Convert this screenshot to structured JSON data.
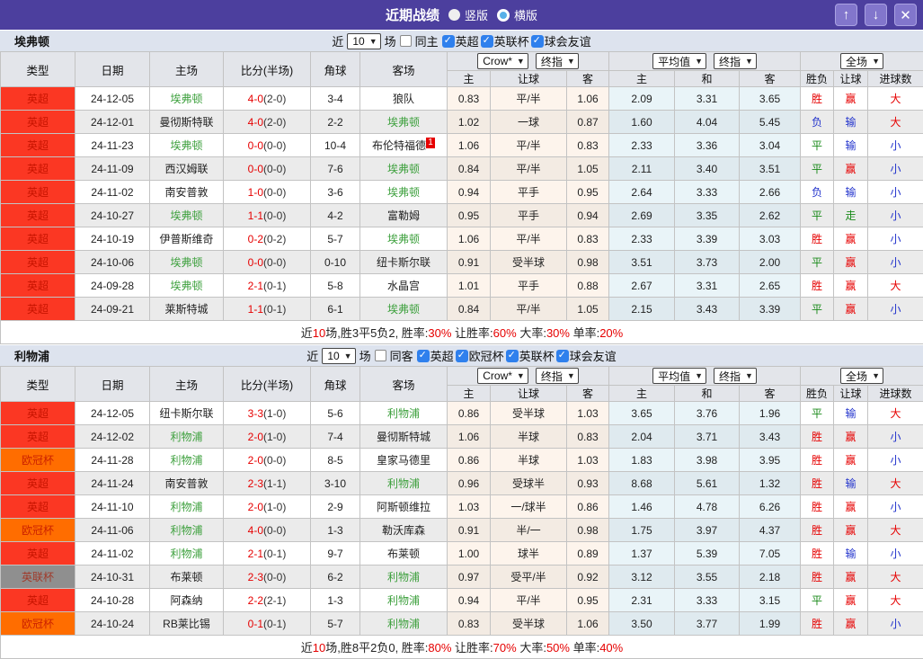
{
  "titlebar": {
    "title": "近期战绩",
    "radio_vertical": "竖版",
    "radio_horizontal": "横版",
    "buttons": {
      "up": "↑",
      "down": "↓",
      "close": "✕"
    }
  },
  "table_header": {
    "cols": [
      "类型",
      "日期",
      "主场",
      "比分(半场)",
      "角球",
      "客场"
    ],
    "sub": [
      "主",
      "让球",
      "客",
      "主",
      "和",
      "客",
      "胜负",
      "让球",
      "进球数"
    ],
    "selects": {
      "bookmaker": "Crow*",
      "asian_time": "终指",
      "euro_source": "平均值",
      "euro_time": "终指",
      "period": "全场"
    }
  },
  "type_colors": {
    "英超": {
      "bg": "#fb3723",
      "fg": "#c81400"
    },
    "欧冠杯": {
      "bg": "#ff6d00",
      "fg": "#cc2200"
    },
    "英联杯": {
      "bg": "#8f8f8f",
      "fg": "#a03a2a"
    }
  },
  "result_colors": {
    "胜": "#e60000",
    "平": "#1a8a1a",
    "负": "#2233cc",
    "赢": "#e60000",
    "走": "#1a8a1a",
    "输": "#2233cc",
    "大": "#e60000",
    "小": "#2233cc"
  },
  "sections": [
    {
      "team": "埃弗顿",
      "filter": {
        "prefix": "近",
        "count": "10",
        "suffix": "场",
        "same": "同主",
        "leagues": [
          "英超",
          "英联杯",
          "球会友谊"
        ]
      },
      "rows": [
        {
          "type": "英超",
          "date": "24-12-05",
          "home": "埃弗顿",
          "homeFocal": true,
          "score": "4-0",
          "half": "(2-0)",
          "corner": "3-4",
          "away": "狼队",
          "awayFocal": false,
          "ah": "0.83",
          "hcap": "平/半",
          "aa": "1.06",
          "eh": "2.09",
          "ed": "3.31",
          "ea": "3.65",
          "wl": "胜",
          "hd": "赢",
          "gl": "大"
        },
        {
          "type": "英超",
          "date": "24-12-01",
          "home": "曼彻斯特联",
          "homeFocal": false,
          "score": "4-0",
          "half": "(2-0)",
          "corner": "2-2",
          "away": "埃弗顿",
          "awayFocal": true,
          "ah": "1.02",
          "hcap": "一球",
          "aa": "0.87",
          "eh": "1.60",
          "ed": "4.04",
          "ea": "5.45",
          "wl": "负",
          "hd": "输",
          "gl": "大"
        },
        {
          "type": "英超",
          "date": "24-11-23",
          "home": "埃弗顿",
          "homeFocal": true,
          "score": "0-0",
          "half": "(0-0)",
          "corner": "10-4",
          "away": "布伦特福德",
          "awayFocal": false,
          "badge": "1",
          "ah": "1.06",
          "hcap": "平/半",
          "aa": "0.83",
          "eh": "2.33",
          "ed": "3.36",
          "ea": "3.04",
          "wl": "平",
          "hd": "输",
          "gl": "小"
        },
        {
          "type": "英超",
          "date": "24-11-09",
          "home": "西汉姆联",
          "homeFocal": false,
          "score": "0-0",
          "half": "(0-0)",
          "corner": "7-6",
          "away": "埃弗顿",
          "awayFocal": true,
          "ah": "0.84",
          "hcap": "平/半",
          "aa": "1.05",
          "eh": "2.11",
          "ed": "3.40",
          "ea": "3.51",
          "wl": "平",
          "hd": "赢",
          "gl": "小"
        },
        {
          "type": "英超",
          "date": "24-11-02",
          "home": "南安普敦",
          "homeFocal": false,
          "score": "1-0",
          "half": "(0-0)",
          "corner": "3-6",
          "away": "埃弗顿",
          "awayFocal": true,
          "ah": "0.94",
          "hcap": "平手",
          "aa": "0.95",
          "eh": "2.64",
          "ed": "3.33",
          "ea": "2.66",
          "wl": "负",
          "hd": "输",
          "gl": "小"
        },
        {
          "type": "英超",
          "date": "24-10-27",
          "home": "埃弗顿",
          "homeFocal": true,
          "score": "1-1",
          "half": "(0-0)",
          "corner": "4-2",
          "away": "富勒姆",
          "awayFocal": false,
          "ah": "0.95",
          "hcap": "平手",
          "aa": "0.94",
          "eh": "2.69",
          "ed": "3.35",
          "ea": "2.62",
          "wl": "平",
          "hd": "走",
          "gl": "小"
        },
        {
          "type": "英超",
          "date": "24-10-19",
          "home": "伊普斯维奇",
          "homeFocal": false,
          "score": "0-2",
          "half": "(0-2)",
          "corner": "5-7",
          "away": "埃弗顿",
          "awayFocal": true,
          "ah": "1.06",
          "hcap": "平/半",
          "aa": "0.83",
          "eh": "2.33",
          "ed": "3.39",
          "ea": "3.03",
          "wl": "胜",
          "hd": "赢",
          "gl": "小"
        },
        {
          "type": "英超",
          "date": "24-10-06",
          "home": "埃弗顿",
          "homeFocal": true,
          "score": "0-0",
          "half": "(0-0)",
          "corner": "0-10",
          "away": "纽卡斯尔联",
          "awayFocal": false,
          "ah": "0.91",
          "hcap": "受半球",
          "aa": "0.98",
          "eh": "3.51",
          "ed": "3.73",
          "ea": "2.00",
          "wl": "平",
          "hd": "赢",
          "gl": "小"
        },
        {
          "type": "英超",
          "date": "24-09-28",
          "home": "埃弗顿",
          "homeFocal": true,
          "score": "2-1",
          "half": "(0-1)",
          "corner": "5-8",
          "away": "水晶宫",
          "awayFocal": false,
          "ah": "1.01",
          "hcap": "平手",
          "aa": "0.88",
          "eh": "2.67",
          "ed": "3.31",
          "ea": "2.65",
          "wl": "胜",
          "hd": "赢",
          "gl": "大"
        },
        {
          "type": "英超",
          "date": "24-09-21",
          "home": "莱斯特城",
          "homeFocal": false,
          "score": "1-1",
          "half": "(0-1)",
          "corner": "6-1",
          "away": "埃弗顿",
          "awayFocal": true,
          "ah": "0.84",
          "hcap": "平/半",
          "aa": "1.05",
          "eh": "2.15",
          "ed": "3.43",
          "ea": "3.39",
          "wl": "平",
          "hd": "赢",
          "gl": "小"
        }
      ],
      "summary": [
        {
          "t": "近",
          "r": false
        },
        {
          "t": "10",
          "r": true
        },
        {
          "t": "场,胜3平5负2, 胜率:",
          "r": false
        },
        {
          "t": "30%",
          "r": true
        },
        {
          "t": " 让胜率:",
          "r": false
        },
        {
          "t": "60%",
          "r": true
        },
        {
          "t": " 大率:",
          "r": false
        },
        {
          "t": "30%",
          "r": true
        },
        {
          "t": " 单率:",
          "r": false
        },
        {
          "t": "20%",
          "r": true
        }
      ]
    },
    {
      "team": "利物浦",
      "filter": {
        "prefix": "近",
        "count": "10",
        "suffix": "场",
        "same": "同客",
        "leagues": [
          "英超",
          "欧冠杯",
          "英联杯",
          "球会友谊"
        ]
      },
      "rows": [
        {
          "type": "英超",
          "date": "24-12-05",
          "home": "纽卡斯尔联",
          "homeFocal": false,
          "score": "3-3",
          "half": "(1-0)",
          "corner": "5-6",
          "away": "利物浦",
          "awayFocal": true,
          "ah": "0.86",
          "hcap": "受半球",
          "aa": "1.03",
          "eh": "3.65",
          "ed": "3.76",
          "ea": "1.96",
          "wl": "平",
          "hd": "输",
          "gl": "大"
        },
        {
          "type": "英超",
          "date": "24-12-02",
          "home": "利物浦",
          "homeFocal": true,
          "score": "2-0",
          "half": "(1-0)",
          "corner": "7-4",
          "away": "曼彻斯特城",
          "awayFocal": false,
          "ah": "1.06",
          "hcap": "半球",
          "aa": "0.83",
          "eh": "2.04",
          "ed": "3.71",
          "ea": "3.43",
          "wl": "胜",
          "hd": "赢",
          "gl": "小"
        },
        {
          "type": "欧冠杯",
          "date": "24-11-28",
          "home": "利物浦",
          "homeFocal": true,
          "score": "2-0",
          "half": "(0-0)",
          "corner": "8-5",
          "away": "皇家马德里",
          "awayFocal": false,
          "ah": "0.86",
          "hcap": "半球",
          "aa": "1.03",
          "eh": "1.83",
          "ed": "3.98",
          "ea": "3.95",
          "wl": "胜",
          "hd": "赢",
          "gl": "小"
        },
        {
          "type": "英超",
          "date": "24-11-24",
          "home": "南安普敦",
          "homeFocal": false,
          "score": "2-3",
          "half": "(1-1)",
          "corner": "3-10",
          "away": "利物浦",
          "awayFocal": true,
          "ah": "0.96",
          "hcap": "受球半",
          "aa": "0.93",
          "eh": "8.68",
          "ed": "5.61",
          "ea": "1.32",
          "wl": "胜",
          "hd": "输",
          "gl": "大"
        },
        {
          "type": "英超",
          "date": "24-11-10",
          "home": "利物浦",
          "homeFocal": true,
          "score": "2-0",
          "half": "(1-0)",
          "corner": "2-9",
          "away": "阿斯顿维拉",
          "awayFocal": false,
          "ah": "1.03",
          "hcap": "一/球半",
          "aa": "0.86",
          "eh": "1.46",
          "ed": "4.78",
          "ea": "6.26",
          "wl": "胜",
          "hd": "赢",
          "gl": "小"
        },
        {
          "type": "欧冠杯",
          "date": "24-11-06",
          "home": "利物浦",
          "homeFocal": true,
          "score": "4-0",
          "half": "(0-0)",
          "corner": "1-3",
          "away": "勒沃库森",
          "awayFocal": false,
          "ah": "0.91",
          "hcap": "半/一",
          "aa": "0.98",
          "eh": "1.75",
          "ed": "3.97",
          "ea": "4.37",
          "wl": "胜",
          "hd": "赢",
          "gl": "大"
        },
        {
          "type": "英超",
          "date": "24-11-02",
          "home": "利物浦",
          "homeFocal": true,
          "score": "2-1",
          "half": "(0-1)",
          "corner": "9-7",
          "away": "布莱顿",
          "awayFocal": false,
          "ah": "1.00",
          "hcap": "球半",
          "aa": "0.89",
          "eh": "1.37",
          "ed": "5.39",
          "ea": "7.05",
          "wl": "胜",
          "hd": "输",
          "gl": "小"
        },
        {
          "type": "英联杯",
          "date": "24-10-31",
          "home": "布莱顿",
          "homeFocal": false,
          "score": "2-3",
          "half": "(0-0)",
          "corner": "6-2",
          "away": "利物浦",
          "awayFocal": true,
          "ah": "0.97",
          "hcap": "受平/半",
          "aa": "0.92",
          "eh": "3.12",
          "ed": "3.55",
          "ea": "2.18",
          "wl": "胜",
          "hd": "赢",
          "gl": "大"
        },
        {
          "type": "英超",
          "date": "24-10-28",
          "home": "阿森纳",
          "homeFocal": false,
          "score": "2-2",
          "half": "(2-1)",
          "corner": "1-3",
          "away": "利物浦",
          "awayFocal": true,
          "ah": "0.94",
          "hcap": "平/半",
          "aa": "0.95",
          "eh": "2.31",
          "ed": "3.33",
          "ea": "3.15",
          "wl": "平",
          "hd": "赢",
          "gl": "大"
        },
        {
          "type": "欧冠杯",
          "date": "24-10-24",
          "home": "RB莱比锡",
          "homeFocal": false,
          "score": "0-1",
          "half": "(0-1)",
          "corner": "5-7",
          "away": "利物浦",
          "awayFocal": true,
          "ah": "0.83",
          "hcap": "受半球",
          "aa": "1.06",
          "eh": "3.50",
          "ed": "3.77",
          "ea": "1.99",
          "wl": "胜",
          "hd": "赢",
          "gl": "小"
        }
      ],
      "summary": [
        {
          "t": "近",
          "r": false
        },
        {
          "t": "10",
          "r": true
        },
        {
          "t": "场,胜8平2负0, 胜率:",
          "r": false
        },
        {
          "t": "80%",
          "r": true
        },
        {
          "t": " 让胜率:",
          "r": false
        },
        {
          "t": "70%",
          "r": true
        },
        {
          "t": " 大率:",
          "r": false
        },
        {
          "t": "50%",
          "r": true
        },
        {
          "t": " 单率:",
          "r": false
        },
        {
          "t": "40%",
          "r": true
        }
      ]
    }
  ]
}
